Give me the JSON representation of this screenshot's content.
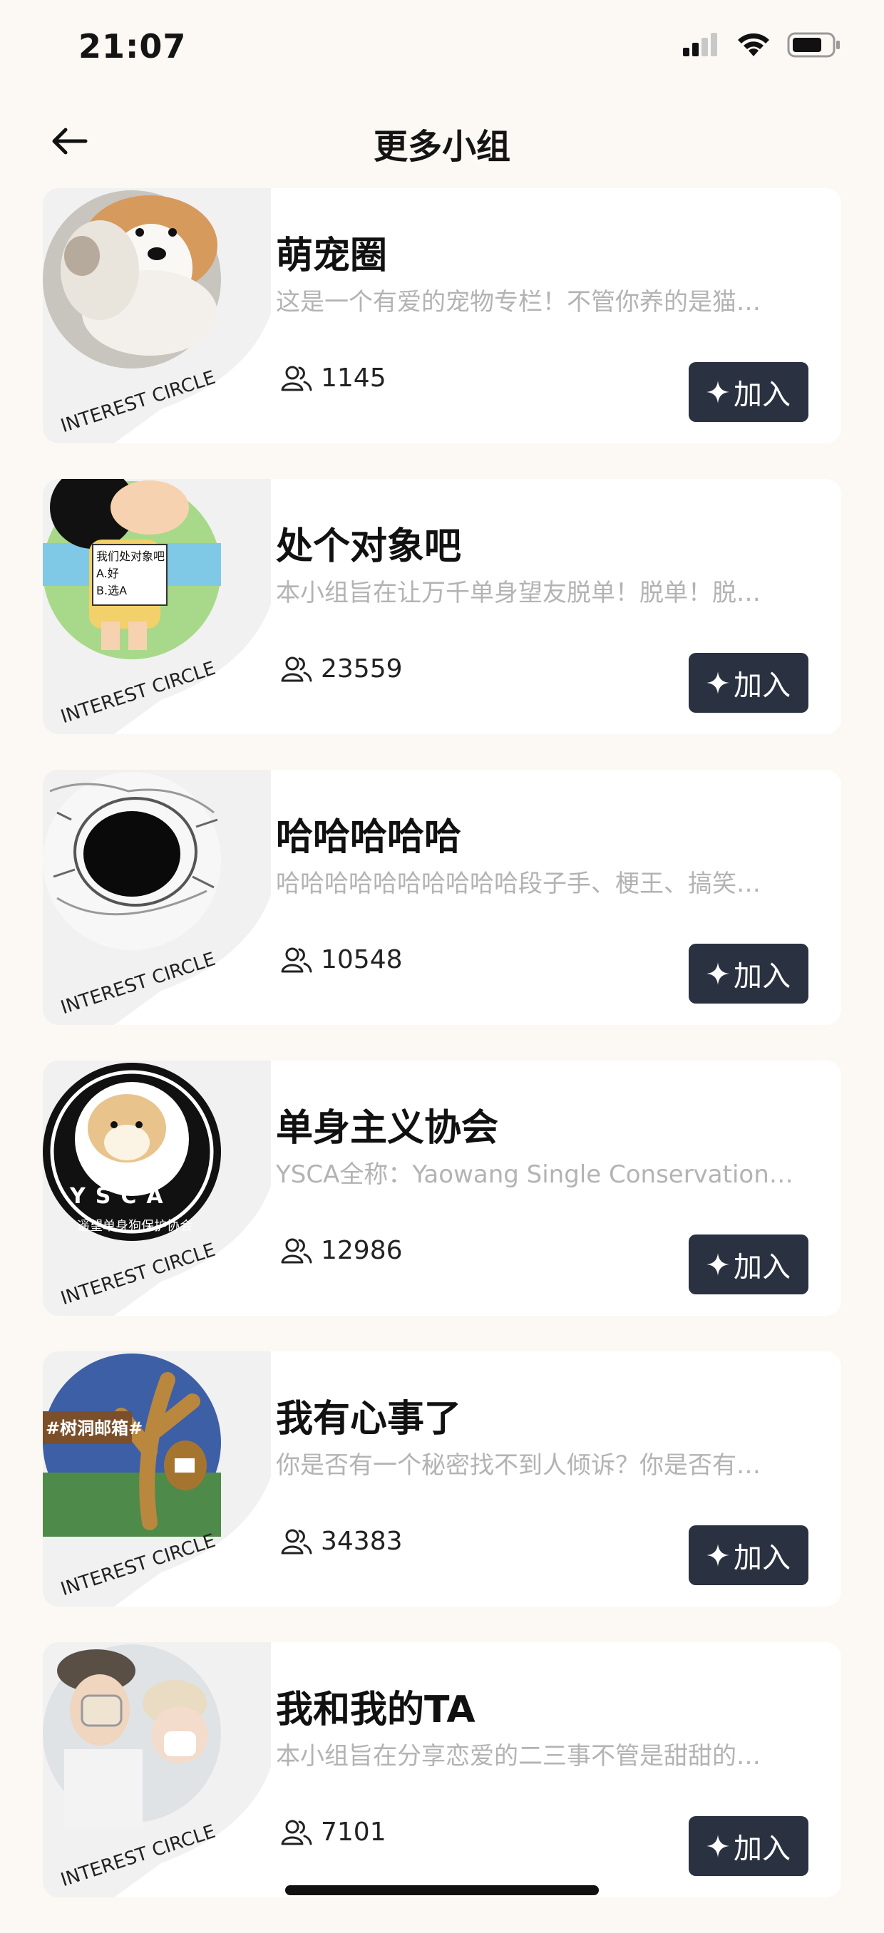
{
  "status_bar": {
    "time": "21:07"
  },
  "header": {
    "title": "更多小组"
  },
  "groups": [
    {
      "title": "萌宠圈",
      "desc": "这是一个有爱的宠物专栏！不管你养的是猫…",
      "members": "1145",
      "join_label": "加入",
      "badge_text": "INTEREST CIRCLE",
      "image": "cat-and-corgi-photo"
    },
    {
      "title": "处个对象吧",
      "desc": "本小组旨在让万千单身望友脱单！脱单！脱…",
      "members": "23559",
      "join_label": "加入",
      "badge_text": "INTEREST CIRCLE",
      "image": "cartoon-boy-with-sign",
      "image_caption_lines": [
        "我们处对象吧",
        "A.好",
        "B.选A"
      ]
    },
    {
      "title": "哈哈哈哈哈",
      "desc": "哈哈哈哈哈哈哈哈哈哈段子手、梗王、搞笑…",
      "members": "10548",
      "join_label": "加入",
      "badge_text": "INTEREST CIRCLE",
      "image": "laughing-meme-sketch"
    },
    {
      "title": "单身主义协会",
      "desc": "YSCA全称：Yaowang Single Conservation…",
      "members": "12986",
      "join_label": "加入",
      "badge_text": "INTEREST CIRCLE",
      "image": "doge-ysca-logo",
      "logo_text": "YSCA",
      "logo_subtext": "遥望单身狗保护协会"
    },
    {
      "title": "我有心事了",
      "desc": "你是否有一个秘密找不到人倾诉？你是否有…",
      "members": "34383",
      "join_label": "加入",
      "badge_text": "INTEREST CIRCLE",
      "image": "tree-hole-mailbox-illustration",
      "sign_text": "#树洞邮箱#"
    },
    {
      "title": "我和我的TA",
      "desc": "本小组旨在分享恋爱的二三事不管是甜甜的…",
      "members": "7101",
      "join_label": "加入",
      "badge_text": "INTEREST CIRCLE",
      "image": "couple-photo"
    }
  ],
  "colors": {
    "background": "#fcf9f4",
    "card": "#ffffff",
    "join_button": "#2a3140",
    "desc_text": "#b3b3b3"
  },
  "icons": {
    "back": "arrow-left-icon",
    "members": "people-icon",
    "join": "sparkle-icon",
    "signal": "cellular-signal-icon",
    "wifi": "wifi-icon",
    "battery": "battery-icon"
  }
}
